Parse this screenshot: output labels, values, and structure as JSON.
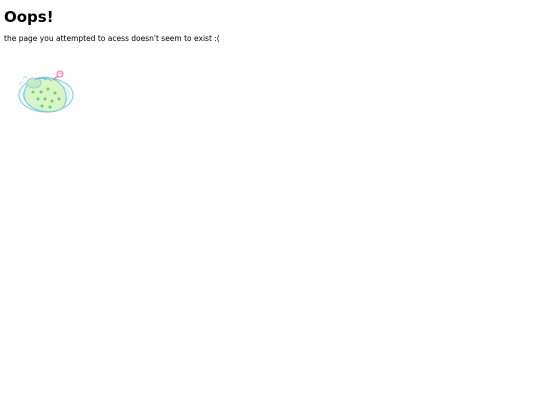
{
  "error_page": {
    "title": "Oops!",
    "message": "the page you attempted to acess doesn't seem to exist :("
  },
  "illustration": {
    "icon": "sleeping-in-bed-icon",
    "colors": {
      "blanket": "#d7f5c7",
      "dots": "#6fd06a",
      "outline": "#8fd2e6",
      "lollipop": "#e77aa0"
    }
  }
}
